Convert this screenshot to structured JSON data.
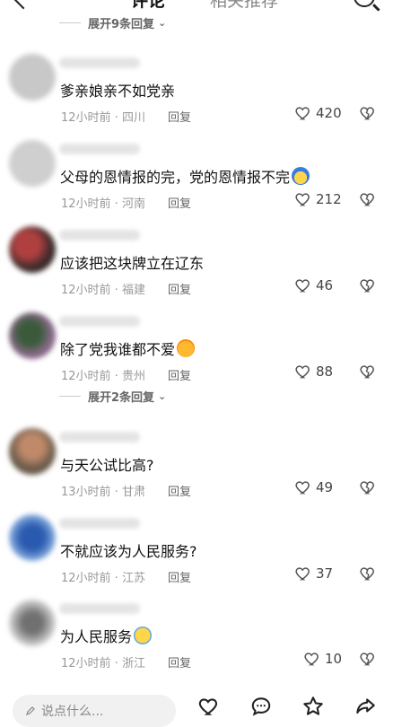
{
  "header": {
    "tab_comments": "评论",
    "tab_related": "相关推荐"
  },
  "expand_top": "展开9条回复",
  "expand_mid": "展开2条回复",
  "comments": [
    {
      "text": "爹亲娘亲不如党亲",
      "emoji": "",
      "time": "12小时前",
      "location": "四川",
      "reply": "回复",
      "likes": "420",
      "avatar_color": "#c8c8c8"
    },
    {
      "text": "父母的恩情报的完，党的恩情报不完",
      "emoji": "cold-face",
      "time": "12小时前",
      "location": "河南",
      "reply": "回复",
      "likes": "212",
      "avatar_color": "#cfcfcf"
    },
    {
      "text": "应该把这块牌立在辽东",
      "emoji": "",
      "time": "12小时前",
      "location": "福建",
      "reply": "回复",
      "likes": "46",
      "avatar_color": "#6a3b3b"
    },
    {
      "text": "除了党我谁都不爱",
      "emoji": "rofl-face",
      "time": "12小时前",
      "location": "贵州",
      "reply": "回复",
      "likes": "88",
      "avatar_color": "#6b5a4a"
    },
    {
      "text": "与天公试比高?",
      "emoji": "",
      "time": "13小时前",
      "location": "甘肃",
      "reply": "回复",
      "likes": "49",
      "avatar_color": "#8a7a6a"
    },
    {
      "text": "不就应该为人民服务?",
      "emoji": "",
      "time": "12小时前",
      "location": "江苏",
      "reply": "回复",
      "likes": "37",
      "avatar_color": "#4a78c0"
    },
    {
      "text": "为人民服务",
      "emoji": "crying-face",
      "time": "12小时前",
      "location": "浙江",
      "reply": "回复",
      "likes": "10",
      "avatar_color": "#9a9a9a"
    }
  ],
  "bottom": {
    "placeholder": "说点什么...",
    "icons": [
      "heart-icon",
      "comment-icon",
      "star-icon",
      "share-icon"
    ]
  }
}
